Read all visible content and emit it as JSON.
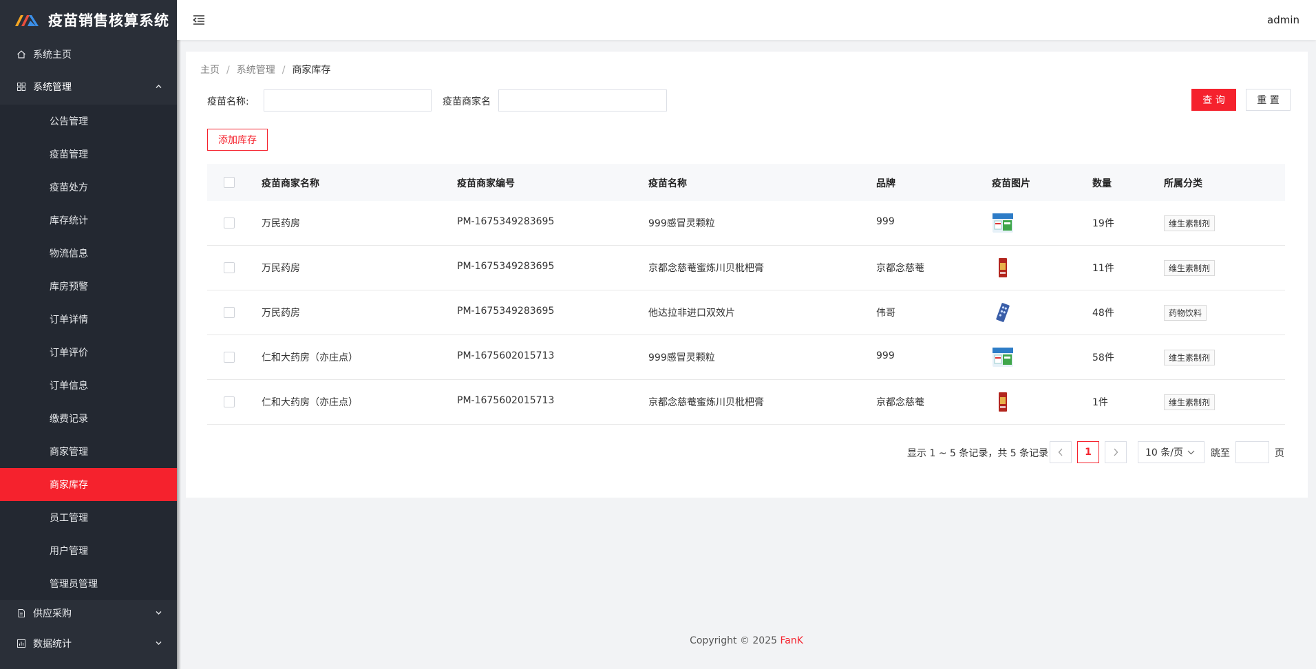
{
  "app": {
    "title": "疫苗销售核算系统",
    "user": "admin"
  },
  "sidebar": {
    "home": "系统主页",
    "system_group": "系统管理",
    "items": [
      {
        "label": "公告管理"
      },
      {
        "label": "疫苗管理"
      },
      {
        "label": "疫苗处方"
      },
      {
        "label": "库存统计"
      },
      {
        "label": "物流信息"
      },
      {
        "label": "库房预警"
      },
      {
        "label": "订单详情"
      },
      {
        "label": "订单评价"
      },
      {
        "label": "订单信息"
      },
      {
        "label": "缴费记录"
      },
      {
        "label": "商家管理"
      },
      {
        "label": "商家库存"
      },
      {
        "label": "员工管理"
      },
      {
        "label": "用户管理"
      },
      {
        "label": "管理员管理"
      }
    ],
    "active_index": 11,
    "procurement_group": "供应采购",
    "stats_group": "数据统计"
  },
  "breadcrumb": {
    "home": "主页",
    "section": "系统管理",
    "current": "商家库存"
  },
  "search": {
    "vaccine_name_label": "疫苗名称:",
    "vaccine_name_value": "",
    "merchant_name_label": "疫苗商家名",
    "merchant_name_value": "",
    "query_label": "查 询",
    "reset_label": "重 置"
  },
  "actions": {
    "add_label": "添加库存"
  },
  "table": {
    "columns": [
      "疫苗商家名称",
      "疫苗商家编号",
      "疫苗名称",
      "品牌",
      "疫苗图片",
      "数量",
      "所属分类"
    ],
    "rows": [
      {
        "merchant": "万民药房",
        "code": "PM-1675349283695",
        "name": "999感冒灵颗粒",
        "brand": "999",
        "image": "box-green-blue",
        "qty": "19件",
        "category": "维生素制剂"
      },
      {
        "merchant": "万民药房",
        "code": "PM-1675349283695",
        "name": "京都念慈菴蜜炼川贝枇杷膏",
        "brand": "京都念慈菴",
        "image": "box-red",
        "qty": "11件",
        "category": "维生素制剂"
      },
      {
        "merchant": "万民药房",
        "code": "PM-1675349283695",
        "name": "他达拉非进口双效片",
        "brand": "伟哥",
        "image": "blister-blue",
        "qty": "48件",
        "category": "药物饮料"
      },
      {
        "merchant": "仁和大药房（亦庄点）",
        "code": "PM-1675602015713",
        "name": "999感冒灵颗粒",
        "brand": "999",
        "image": "box-green-blue",
        "qty": "58件",
        "category": "维生素制剂"
      },
      {
        "merchant": "仁和大药房（亦庄点）",
        "code": "PM-1675602015713",
        "name": "京都念慈菴蜜炼川贝枇杷膏",
        "brand": "京都念慈菴",
        "image": "box-red",
        "qty": "1件",
        "category": "维生素制剂"
      }
    ]
  },
  "pagination": {
    "summary": "显示 1 ~ 5 条记录，共 5 条记录",
    "current_page": "1",
    "page_size": "10 条/页",
    "jump_label": "跳至",
    "jump_value": "",
    "page_unit": "页"
  },
  "footer": {
    "copyright": "Copyright © 2025",
    "brand": "FanK"
  },
  "colors": {
    "accent": "#f5222d",
    "sidebar": "#2a2f38"
  }
}
